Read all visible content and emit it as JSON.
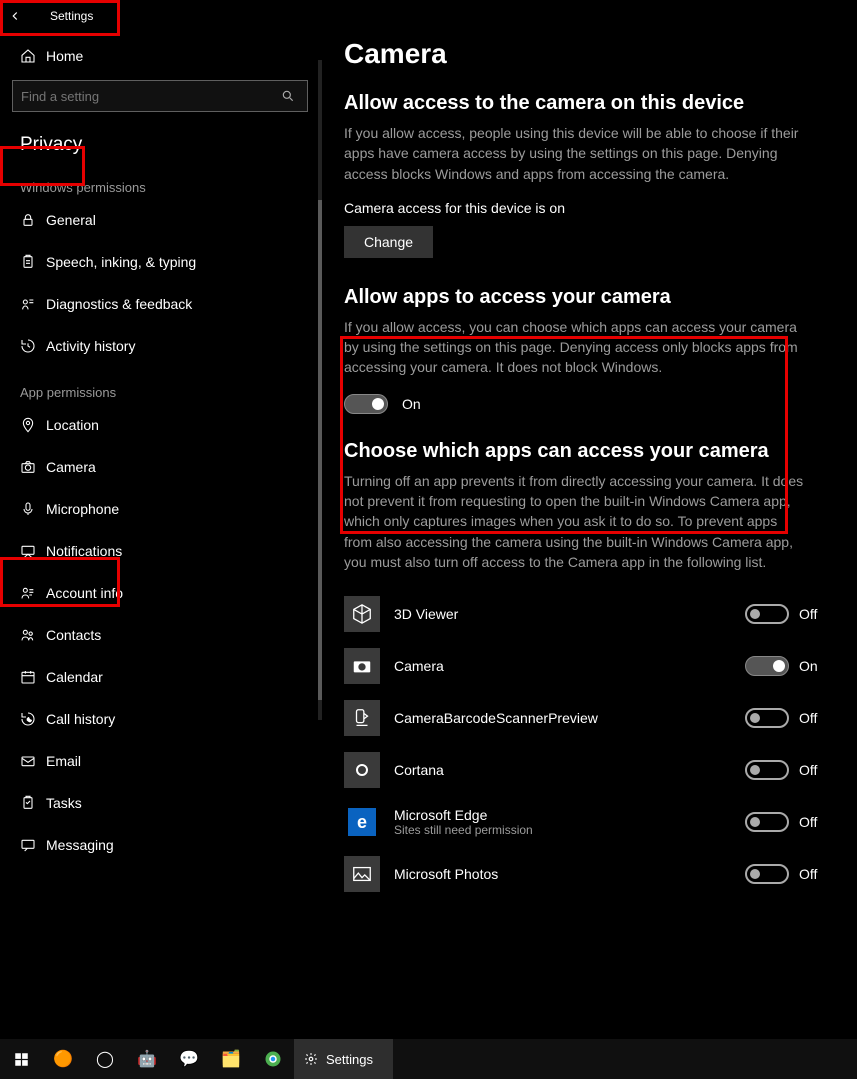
{
  "window": {
    "title": "Settings"
  },
  "sidebar": {
    "home": "Home",
    "search_placeholder": "Find a setting",
    "category": "Privacy",
    "section_windows": "Windows permissions",
    "section_app": "App permissions",
    "win_perms": [
      {
        "icon": "lock-icon",
        "label": "General"
      },
      {
        "icon": "clipboard-icon",
        "label": "Speech, inking, & typing"
      },
      {
        "icon": "feedback-icon",
        "label": "Diagnostics & feedback"
      },
      {
        "icon": "history-icon",
        "label": "Activity history"
      }
    ],
    "app_perms": [
      {
        "icon": "location-icon",
        "label": "Location"
      },
      {
        "icon": "camera-icon",
        "label": "Camera"
      },
      {
        "icon": "microphone-icon",
        "label": "Microphone"
      },
      {
        "icon": "notification-icon",
        "label": "Notifications"
      },
      {
        "icon": "account-icon",
        "label": "Account info"
      },
      {
        "icon": "contacts-icon",
        "label": "Contacts"
      },
      {
        "icon": "calendar-icon",
        "label": "Calendar"
      },
      {
        "icon": "callhistory-icon",
        "label": "Call history"
      },
      {
        "icon": "email-icon",
        "label": "Email"
      },
      {
        "icon": "tasks-icon",
        "label": "Tasks"
      },
      {
        "icon": "messaging-icon",
        "label": "Messaging"
      }
    ]
  },
  "main": {
    "title": "Camera",
    "sec1_title": "Allow access to the camera on this device",
    "sec1_desc": "If you allow access, people using this device will be able to choose if their apps have camera access by using the settings on this page. Denying access blocks Windows and apps from accessing the camera.",
    "sec1_status": "Camera access for this device is on",
    "change_btn": "Change",
    "sec2_title": "Allow apps to access your camera",
    "sec2_desc": "If you allow access, you can choose which apps can access your camera by using the settings on this page. Denying access only blocks apps from accessing your camera. It does not block Windows.",
    "sec2_toggle_on": true,
    "on_label": "On",
    "off_label": "Off",
    "sec3_title": "Choose which apps can access your camera",
    "sec3_desc": "Turning off an app prevents it from directly accessing your camera. It does not prevent it from requesting to open the built-in Windows Camera app, which only captures images when you ask it to do so. To prevent apps from also accessing the camera using the built-in Windows Camera app, you must also turn off access to the Camera app in the following list.",
    "apps": [
      {
        "name": "3D Viewer",
        "on": false,
        "icon": "cube-icon"
      },
      {
        "name": "Camera",
        "on": true,
        "icon": "camera-app-icon"
      },
      {
        "name": "CameraBarcodeScannerPreview",
        "on": false,
        "icon": "scanner-icon"
      },
      {
        "name": "Cortana",
        "on": false,
        "icon": "cortana-icon"
      },
      {
        "name": "Microsoft Edge",
        "on": false,
        "icon": "edge-icon",
        "note": "Sites still need permission"
      },
      {
        "name": "Microsoft Photos",
        "on": false,
        "icon": "photos-icon"
      }
    ]
  },
  "taskbar": {
    "app_label": "Settings",
    "icons": [
      "start-icon",
      "tray1-icon",
      "tray2-icon",
      "tray3-icon",
      "tray4-icon",
      "explorer-icon",
      "chrome-icon"
    ]
  }
}
